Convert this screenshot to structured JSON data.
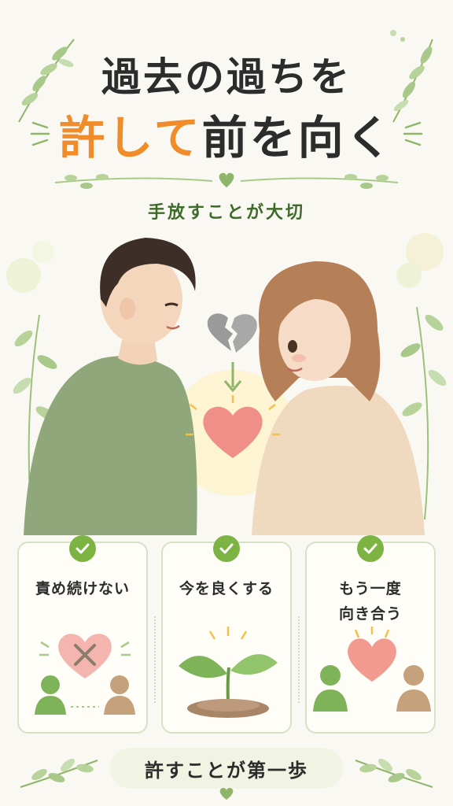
{
  "title": {
    "line1": "過去の過ちを",
    "line2_accent": "許して",
    "line2_rest": "前を向く"
  },
  "subtitle": "手放すことが大切",
  "cards": [
    {
      "text_lines": [
        "責め続けない"
      ],
      "icon": "broken-heart-with-x-icon"
    },
    {
      "text_lines": [
        "今を良くする"
      ],
      "icon": "sprout-icon"
    },
    {
      "text_lines": [
        "もう一度",
        "向き合う"
      ],
      "icon": "heart-between-people-icon"
    }
  ],
  "banner": "許すことが第一歩",
  "colors": {
    "accent": "#f08c2a",
    "green": "#7cb342",
    "subtitle": "#3e6b2a",
    "background": "#faf8f2",
    "heart": "#ef8f88"
  }
}
